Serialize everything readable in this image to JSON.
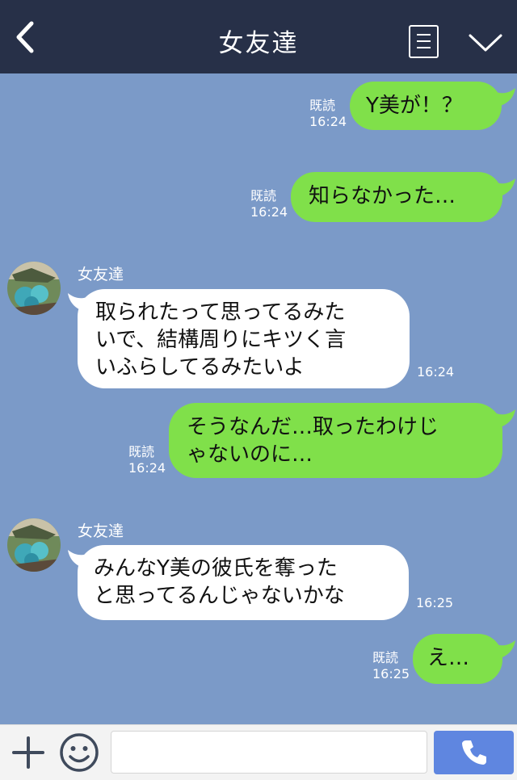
{
  "header": {
    "title": "女友達",
    "back_icon": "chevron-left-icon",
    "menu_icon": "notes-icon",
    "collapse_icon": "chevron-down-icon"
  },
  "contact": {
    "name": "女友達"
  },
  "messages": [
    {
      "direction": "out",
      "text": "Y美が！？",
      "read": "既読",
      "time": "16:24"
    },
    {
      "direction": "out",
      "text": "知らなかった…",
      "read": "既読",
      "time": "16:24"
    },
    {
      "direction": "in",
      "sender": "女友達",
      "lines": [
        "取られたって思ってるみた",
        "いで、結構周りにキツく言",
        "いふらしてるみたいよ"
      ],
      "time": "16:24"
    },
    {
      "direction": "out",
      "lines": [
        "そうなんだ…取ったわけじ",
        "ゃないのに…"
      ],
      "read": "既読",
      "time": "16:24"
    },
    {
      "direction": "in",
      "sender": "女友達",
      "lines": [
        "みんなY美の彼氏を奪った",
        "と思ってるんじゃないかな"
      ],
      "time": "16:25"
    },
    {
      "direction": "out",
      "text": "え…",
      "read": "既読",
      "time": "16:25"
    }
  ],
  "input_bar": {
    "placeholder": "",
    "plus_icon": "plus-icon",
    "emoji_icon": "smiley-icon",
    "call_icon": "phone-icon"
  },
  "colors": {
    "header_bg": "#273048",
    "chat_bg": "#7b9ac8",
    "outgoing_bubble": "#80e04a",
    "incoming_bubble": "#ffffff",
    "call_button": "#5f86e0"
  }
}
